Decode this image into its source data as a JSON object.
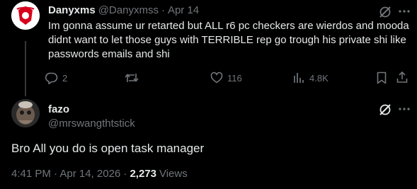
{
  "tweet1": {
    "display_name": "Danyxms",
    "handle": "@Danyxmss",
    "dot": "·",
    "date": "Apr 14",
    "text": "Im gonna assume ur retarted but ALL r6 pc checkers are wierdos and mooda didnt want to let those guys with TERRIBLE rep go trough his private shi like passwords emails and shi",
    "replies": "2",
    "retweets": "",
    "likes": "116",
    "views": "4.8K"
  },
  "tweet2": {
    "display_name": "fazo",
    "handle": "@mrswangthtstick",
    "text": "Bro All you do is open task manager",
    "time": "4:41 PM · Apr 14, 2026 ·",
    "view_count": "2,273",
    "views_label": "Views"
  },
  "colors": {
    "background": "#000000",
    "text": "#e7e9ea",
    "muted": "#71767b",
    "divider": "#333639"
  }
}
